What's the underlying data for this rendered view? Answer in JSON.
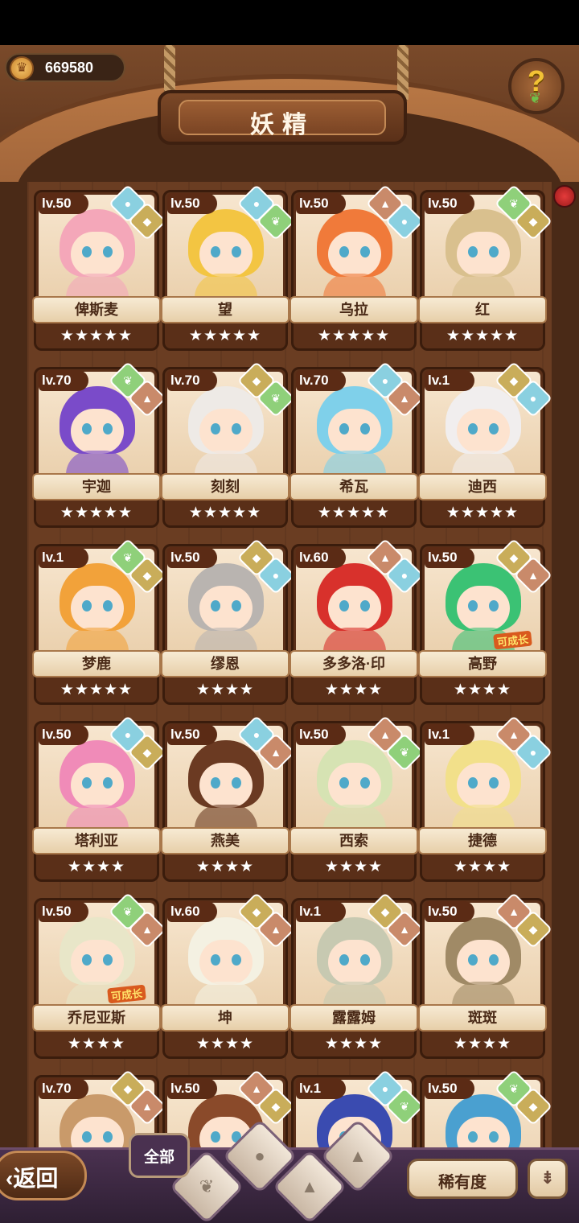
{
  "header": {
    "coins": "669580",
    "title": "妖精",
    "help_icon": "question-sprout-icon"
  },
  "fairies": [
    {
      "level": "lv.50",
      "name": "俾斯麦",
      "stars": "★★★★★",
      "elements": [
        "water",
        "earth"
      ],
      "hair": "#f4a7b9"
    },
    {
      "level": "lv.50",
      "name": "望",
      "stars": "★★★★★",
      "elements": [
        "water",
        "plant"
      ],
      "hair": "#f3c542"
    },
    {
      "level": "lv.50",
      "name": "乌拉",
      "stars": "★★★★★",
      "elements": [
        "mountain",
        "water"
      ],
      "hair": "#f07a3a"
    },
    {
      "level": "lv.50",
      "name": "红",
      "stars": "★★★★★",
      "elements": [
        "plant",
        "earth"
      ],
      "hair": "#d9c08e"
    },
    {
      "level": "lv.70",
      "name": "宇迦",
      "stars": "★★★★★",
      "elements": [
        "plant",
        "mountain"
      ],
      "hair": "#7a4bc9"
    },
    {
      "level": "lv.70",
      "name": "刻刻",
      "stars": "★★★★★",
      "elements": [
        "earth",
        "plant"
      ],
      "hair": "#eeeae6"
    },
    {
      "level": "lv.70",
      "name": "希瓦",
      "stars": "★★★★★",
      "elements": [
        "water",
        "mountain"
      ],
      "hair": "#7fd0ea"
    },
    {
      "level": "lv.1",
      "name": "迪西",
      "stars": "★★★★★",
      "elements": [
        "earth",
        "water"
      ],
      "hair": "#f1eeee"
    },
    {
      "level": "lv.1",
      "name": "梦鹿",
      "stars": "★★★★★",
      "elements": [
        "plant",
        "earth"
      ],
      "hair": "#f2a23a"
    },
    {
      "level": "lv.50",
      "name": "缪恩",
      "stars": "★★★★",
      "elements": [
        "earth",
        "water"
      ],
      "hair": "#b9b4b0"
    },
    {
      "level": "lv.60",
      "name": "多多洛·印",
      "stars": "★★★★",
      "elements": [
        "mountain",
        "water"
      ],
      "hair": "#d8312c"
    },
    {
      "level": "lv.50",
      "name": "高野",
      "stars": "★★★★",
      "elements": [
        "earth",
        "mountain"
      ],
      "hair": "#3bc274",
      "tag": "可成长"
    },
    {
      "level": "lv.50",
      "name": "塔利亚",
      "stars": "★★★★",
      "elements": [
        "water",
        "earth"
      ],
      "hair": "#f08bb8"
    },
    {
      "level": "lv.50",
      "name": "燕美",
      "stars": "★★★★",
      "elements": [
        "water",
        "mountain"
      ],
      "hair": "#6b3a22"
    },
    {
      "level": "lv.50",
      "name": "西索",
      "stars": "★★★★",
      "elements": [
        "mountain",
        "plant"
      ],
      "hair": "#d6e3b3"
    },
    {
      "level": "lv.1",
      "name": "捷德",
      "stars": "★★★★",
      "elements": [
        "mountain",
        "water"
      ],
      "hair": "#f2e08a"
    },
    {
      "level": "lv.50",
      "name": "乔尼亚斯",
      "stars": "★★★★",
      "elements": [
        "plant",
        "mountain"
      ],
      "hair": "#e8e6c8",
      "tag": "可成长"
    },
    {
      "level": "lv.60",
      "name": "坤",
      "stars": "★★★★",
      "elements": [
        "earth",
        "mountain"
      ],
      "hair": "#f4f1e2"
    },
    {
      "level": "lv.1",
      "name": "露露姆",
      "stars": "★★★★",
      "elements": [
        "earth",
        "mountain"
      ],
      "hair": "#c7c9b1"
    },
    {
      "level": "lv.50",
      "name": "斑斑",
      "stars": "★★★★",
      "elements": [
        "mountain",
        "earth"
      ],
      "hair": "#a08a66"
    },
    {
      "level": "lv.70",
      "name": "",
      "stars": "",
      "elements": [
        "earth",
        "mountain"
      ],
      "hair": "#c99a6a"
    },
    {
      "level": "lv.50",
      "name": "",
      "stars": "",
      "elements": [
        "mountain",
        "earth"
      ],
      "hair": "#8a4a2a"
    },
    {
      "level": "lv.1",
      "name": "",
      "stars": "",
      "elements": [
        "water",
        "plant"
      ],
      "hair": "#3a4bb0"
    },
    {
      "level": "lv.50",
      "name": "",
      "stars": "",
      "elements": [
        "plant",
        "earth"
      ],
      "hair": "#4aa0d0"
    }
  ],
  "bottom": {
    "back_label": "返回",
    "filter_all_label": "全部",
    "rarity_label": "稀有度",
    "sort_icon": "sort-list-icon"
  }
}
